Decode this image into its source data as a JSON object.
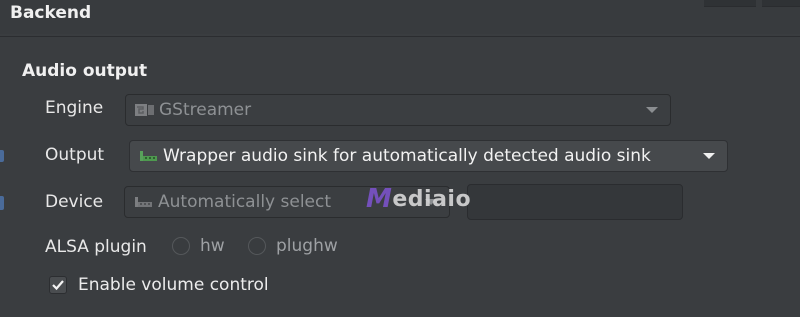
{
  "panel": {
    "title": "Backend"
  },
  "audio_output": {
    "heading": "Audio output",
    "engine": {
      "label": "Engine",
      "value": "GStreamer",
      "icon": "gstreamer-icon"
    },
    "output": {
      "label": "Output",
      "value": "Wrapper audio sink for automatically detected audio sink",
      "icon": "audio-sink-icon"
    },
    "device": {
      "label": "Device",
      "value": "Automatically select",
      "icon": "audio-sink-icon"
    },
    "alsa_plugin": {
      "label": "ALSA plugin",
      "options": [
        "hw",
        "plughw"
      ]
    },
    "volume_control": {
      "label": "Enable volume control",
      "checked": true
    }
  },
  "watermark": {
    "prefix": "M",
    "text": "ediaio"
  }
}
